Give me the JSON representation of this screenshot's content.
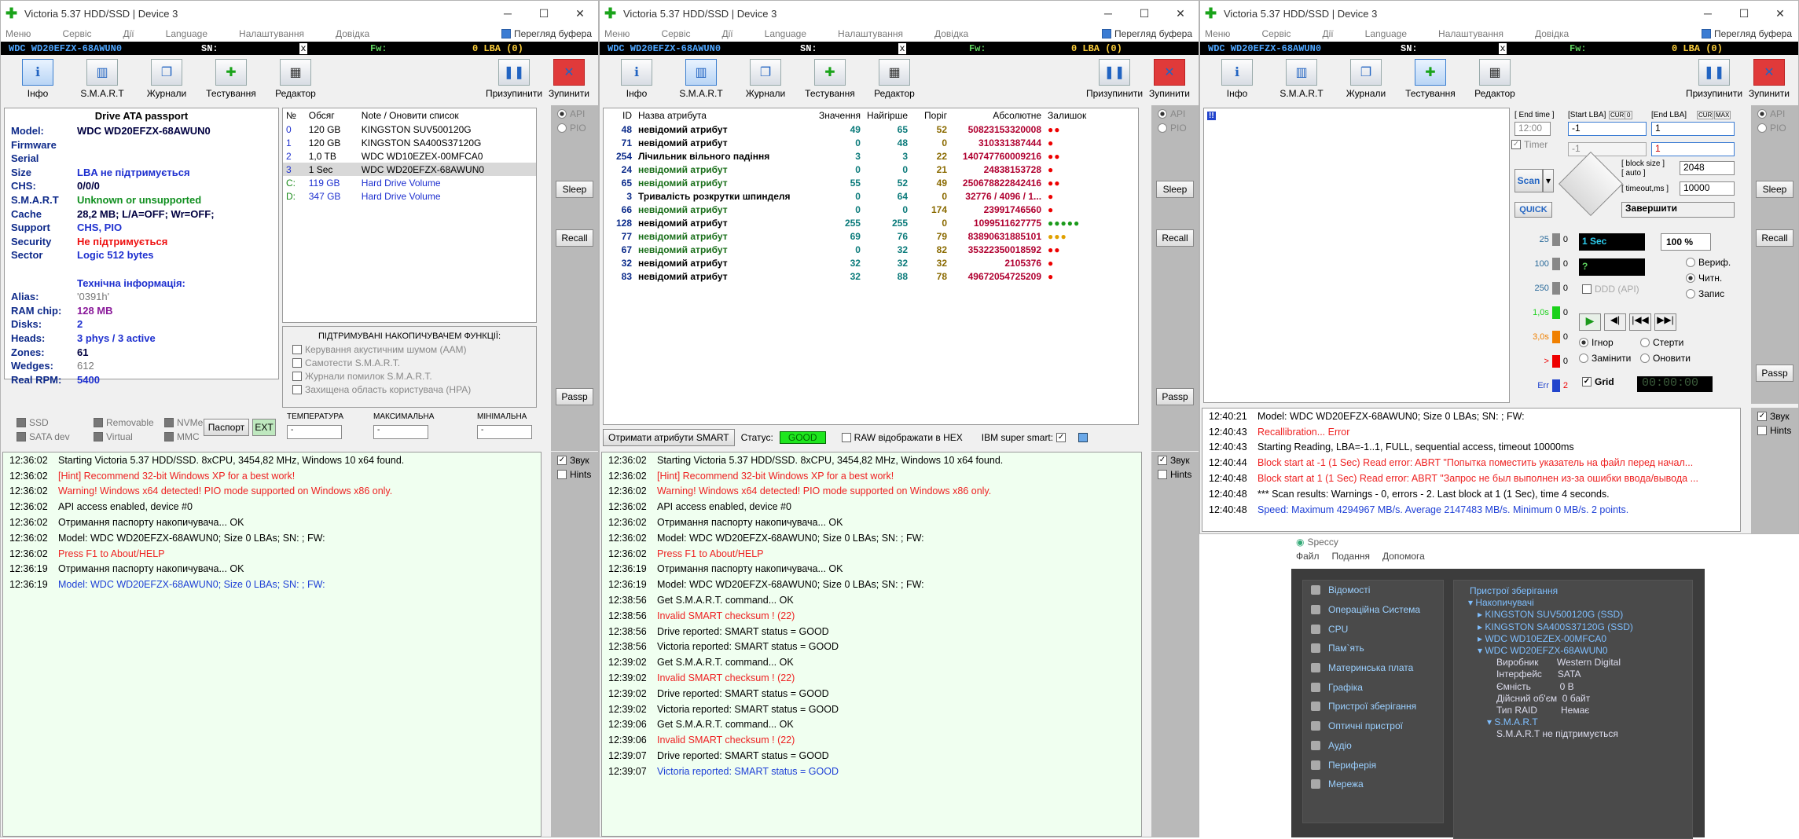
{
  "windows": [
    {
      "title": "Victoria 5.37 HDD/SSD | Device 3"
    },
    {
      "title": "Victoria 5.37 HDD/SSD | Device 3"
    },
    {
      "title": "Victoria 5.37 HDD/SSD | Device 3"
    }
  ],
  "menu": {
    "items": [
      "Меню",
      "Сервіс",
      "Дії",
      "Language",
      "Налаштування",
      "Довідка"
    ],
    "buffer": "Перегляд буфера"
  },
  "devbar": {
    "model": "WDC WD20EFZX-68AWUN0",
    "sn": "SN:",
    "x": "x",
    "fw": "Fw:",
    "lba": "0 LBA (0)"
  },
  "toolbar": {
    "info": "Інфо",
    "smart": "S.M.A.R.T",
    "logs": "Журнали",
    "tests": "Тестування",
    "editor": "Редактор",
    "pause": "Призупинити",
    "stop": "Зупинити"
  },
  "passport": {
    "title": "Drive ATA passport",
    "rows": [
      {
        "k": "Model:",
        "v": "WDC WD20EFZX-68AWUN0",
        "c": ""
      },
      {
        "k": "Firmware",
        "v": "",
        "c": ""
      },
      {
        "k": "Serial",
        "v": "",
        "c": ""
      },
      {
        "k": "Size",
        "v": "LBA не підтримується",
        "c": "blue"
      },
      {
        "k": "CHS:",
        "v": "0/0/0",
        "c": ""
      },
      {
        "k": "S.M.A.R.T",
        "v": "Unknown or unsupported",
        "c": "green"
      },
      {
        "k": "Cache",
        "v": "28,2 MB; L/A=OFF; Wr=OFF;",
        "c": ""
      },
      {
        "k": "Support",
        "v": "CHS, PIO",
        "c": "blue"
      },
      {
        "k": "Security",
        "v": "Не підтримується",
        "c": "red"
      },
      {
        "k": "Sector",
        "v": "Logic 512 bytes",
        "c": "blue"
      },
      {
        "k": "",
        "v": "",
        "c": ""
      },
      {
        "k": "",
        "v": "Технічна інформація:",
        "c": "blue"
      },
      {
        "k": "Alias:",
        "v": "'0391h'",
        "c": "gray"
      },
      {
        "k": "RAM chip:",
        "v": "128 MB",
        "c": "purple"
      },
      {
        "k": "Disks:",
        "v": "2",
        "c": "blue"
      },
      {
        "k": "Heads:",
        "v": "3 phys / 3 active",
        "c": "blue"
      },
      {
        "k": "Zones:",
        "v": "61",
        "c": ""
      },
      {
        "k": "Wedges:",
        "v": "612",
        "c": "gray"
      },
      {
        "k": "Real RPM:",
        "v": "5400",
        "c": "blue"
      }
    ]
  },
  "drives": {
    "headers": [
      "№",
      "Обсяг",
      "Note / Оновити список"
    ],
    "rows": [
      [
        "0",
        "120 GB",
        "KINGSTON SUV500120G"
      ],
      [
        "1",
        "120 GB",
        "KINGSTON SA400S37120G"
      ],
      [
        "2",
        "1,0 TB",
        "WDC WD10EZEX-00MFCA0"
      ],
      [
        "3",
        "1 Sec",
        "WDC WD20EFZX-68AWUN0"
      ],
      [
        "C:",
        "119 GB",
        "Hard Drive Volume"
      ],
      [
        "D:",
        "347 GB",
        "Hard Drive Volume"
      ]
    ]
  },
  "features": {
    "title": "ПІДТРИМУВАНІ НАКОПИЧУВАЧЕМ ФУНКЦІЇ:",
    "items": [
      "Керування акустичним шумом (AAM)",
      "Самотести S.M.A.R.T.",
      "Журнали помилок S.M.A.R.T.",
      "Захищена область користувача (HPA)"
    ]
  },
  "bottom1": {
    "ssd": "SSD",
    "sata": "SATA dev",
    "removable": "Removable",
    "virtual": "Virtual",
    "nvme": "NVMe",
    "mmc": "MMC",
    "passport": "Паспорт",
    "ext": "EXT",
    "temp": "ТЕМПЕРАТУРА",
    "max": "МАКСИМАЛЬНА",
    "min": "МІНІМАЛЬНА",
    "dash": "-"
  },
  "side": {
    "api": "API",
    "pio": "PIO",
    "sleep": "Sleep",
    "recall": "Recall",
    "passp": "Passp",
    "sound": "Звук",
    "hints": "Hints"
  },
  "log1": [
    [
      "12:36:02",
      "Starting Victoria 5.37 HDD/SSD. 8xCPU, 3454,82 MHz, Windows 10 x64 found.",
      ""
    ],
    [
      "12:36:02",
      "[Hint] Recommend 32-bit Windows XP for a best work!",
      "red2"
    ],
    [
      "12:36:02",
      "Warning! Windows x64 detected! PIO mode supported on Windows x86 only.",
      "red2"
    ],
    [
      "12:36:02",
      "API access enabled, device #0",
      ""
    ],
    [
      "12:36:02",
      "Отримання паспорту накопичувача... OK",
      ""
    ],
    [
      "12:36:02",
      "Model: WDC WD20EFZX-68AWUN0; Size 0 LBAs; SN:  ; FW:",
      ""
    ],
    [
      "12:36:02",
      "Press F1 to About/HELP",
      "red2"
    ],
    [
      "12:36:19",
      "Отримання паспорту накопичувача... OK",
      ""
    ],
    [
      "12:36:19",
      "Model: WDC WD20EFZX-68AWUN0; Size 0 LBAs; SN:  ; FW:",
      "blue2"
    ]
  ],
  "smart": {
    "headers": [
      "ID",
      "Назва атрибута",
      "Значення",
      "Найгірше",
      "Поріг",
      "Абсолютне",
      "Залишок"
    ],
    "rows": [
      [
        "48",
        "невідомий атрибут",
        "49",
        "65",
        "52",
        "50823153320008",
        "●●"
      ],
      [
        "71",
        "невідомий атрибут",
        "0",
        "48",
        "0",
        "310331387444",
        "●"
      ],
      [
        "254",
        "Лічильник вільного падіння",
        "3",
        "3",
        "22",
        "140747760009216",
        "●●"
      ],
      [
        "24",
        "невідомий атрибут",
        "0",
        "0",
        "21",
        "24838153728",
        "●"
      ],
      [
        "65",
        "невідомий атрибут",
        "55",
        "52",
        "49",
        "250678822842416",
        "●●"
      ],
      [
        "3",
        "Тривалість розкрутки шпинделя",
        "0",
        "64",
        "0",
        "32776 / 4096 / 1...",
        "●"
      ],
      [
        "66",
        "невідомий атрибут",
        "0",
        "0",
        "174",
        "23991746560",
        "●"
      ],
      [
        "128",
        "невідомий атрибут",
        "255",
        "255",
        "0",
        "1099511627775",
        "●●●●●"
      ],
      [
        "77",
        "невідомий атрибут",
        "69",
        "76",
        "79",
        "83890631885101",
        "●●●"
      ],
      [
        "67",
        "невідомий атрибут",
        "0",
        "32",
        "82",
        "35322350018592",
        "●●"
      ],
      [
        "32",
        "невідомий атрибут",
        "32",
        "32",
        "32",
        "2105376",
        "●"
      ],
      [
        "83",
        "невідомий атрибут",
        "32",
        "88",
        "78",
        "49672054725209",
        "●"
      ]
    ]
  },
  "smartbar": {
    "get": "Отримати атрибути SMART",
    "status_label": "Статус:",
    "status": "GOOD",
    "raw": "RAW відображати в HEX",
    "ibm": "IBM super smart:"
  },
  "log2": [
    [
      "12:36:02",
      "Starting Victoria 5.37 HDD/SSD. 8xCPU, 3454,82 MHz, Windows 10 x64 found.",
      ""
    ],
    [
      "12:36:02",
      "[Hint] Recommend 32-bit Windows XP for a best work!",
      "red2"
    ],
    [
      "12:36:02",
      "Warning! Windows x64 detected! PIO mode supported on Windows x86 only.",
      "red2"
    ],
    [
      "12:36:02",
      "API access enabled, device #0",
      ""
    ],
    [
      "12:36:02",
      "Отримання паспорту накопичувача... OK",
      ""
    ],
    [
      "12:36:02",
      "Model: WDC WD20EFZX-68AWUN0; Size 0 LBAs; SN:  ; FW:",
      ""
    ],
    [
      "12:36:02",
      "Press F1 to About/HELP",
      "red2"
    ],
    [
      "12:36:19",
      "Отримання паспорту накопичувача... OK",
      ""
    ],
    [
      "12:36:19",
      "Model: WDC WD20EFZX-68AWUN0; Size 0 LBAs; SN:  ; FW:",
      ""
    ],
    [
      "12:38:56",
      "Get S.M.A.R.T. command... OK",
      ""
    ],
    [
      "12:38:56",
      "Invalid SMART checksum ! (22)",
      "red2"
    ],
    [
      "12:38:56",
      "Drive reported: SMART status = GOOD",
      ""
    ],
    [
      "12:38:56",
      "Victoria reported: SMART status = GOOD",
      ""
    ],
    [
      "12:39:02",
      "Get S.M.A.R.T. command... OK",
      ""
    ],
    [
      "12:39:02",
      "Invalid SMART checksum ! (22)",
      "red2"
    ],
    [
      "12:39:02",
      "Drive reported: SMART status = GOOD",
      ""
    ],
    [
      "12:39:02",
      "Victoria reported: SMART status = GOOD",
      ""
    ],
    [
      "12:39:06",
      "Get S.M.A.R.T. command... OK",
      ""
    ],
    [
      "12:39:06",
      "Invalid SMART checksum ! (22)",
      "red2"
    ],
    [
      "12:39:07",
      "Drive reported: SMART status = GOOD",
      ""
    ],
    [
      "12:39:07",
      "Victoria reported: SMART status = GOOD",
      "blue2"
    ]
  ],
  "test": {
    "end_time": "[ End time ]",
    "start_lba": "[Start LBA]",
    "cur": "CUR",
    "zero": "0",
    "end_lba": "[End LBA]",
    "max": "MAX",
    "time": "12:00",
    "start_val": "-1",
    "end_val": "1",
    "timer": "Timer",
    "timer_val": "-1",
    "end_val2": "1",
    "scan": "Scan",
    "quick": "QUICK",
    "block_size": "[ block size ]",
    "auto": "[ auto ]",
    "bs_val": "2048",
    "timeout": "[ timeout,ms ]",
    "to_val": "10000",
    "finish": "Завершити",
    "one_sec": "1 Sec",
    "pct": "100 %",
    "q": "?",
    "ddd": "DDD (API)",
    "verify": "Вериф.",
    "read": "Читн.",
    "write": "Запис",
    "ignore": "Ігнор",
    "erase": "Стерти",
    "replace": "Замінити",
    "update": "Оновити",
    "grid": "Grid",
    "timer_disp": "00:00:00",
    "mark": "!!",
    "hist": [
      [
        "25",
        "0"
      ],
      [
        "100",
        "0"
      ],
      [
        "250",
        "0"
      ],
      [
        "1,0s",
        "0"
      ],
      [
        "3,0s",
        "0"
      ],
      [
        ">",
        "0"
      ],
      [
        "Err",
        "2"
      ]
    ]
  },
  "log3": [
    [
      "12:40:21",
      "Model: WDC WD20EFZX-68AWUN0; Size 0 LBAs; SN:  ; FW:",
      ""
    ],
    [
      "12:40:43",
      "Recallibration... Error",
      "red2"
    ],
    [
      "12:40:43",
      "Starting Reading, LBA=-1..1, FULL, sequential access, timeout 10000ms",
      ""
    ],
    [
      "12:40:44",
      "Block start at -1 (1 Sec) Read error: ABRT \"Попытка поместить указатель на файл перед начал...",
      "red2"
    ],
    [
      "12:40:48",
      "Block start at 1 (1 Sec) Read error: ABRT \"Запрос не был выполнен из-за ошибки ввода/вывода ...",
      "red2"
    ],
    [
      "12:40:48",
      "*** Scan results: Warnings - 0, errors - 2. Last block at 1 (1 Sec), time 4 seconds.",
      ""
    ],
    [
      "12:40:48",
      "Speed: Maximum 4294967 MB/s. Average 2147483 MB/s. Minimum 0 MB/s. 2 points.",
      "blue2"
    ]
  ],
  "speccy": {
    "title": "Speccy",
    "menu": [
      "Файл",
      "Подання",
      "Допомога"
    ],
    "left": [
      "Відомості",
      "Операційна Система",
      "CPU",
      "Пам`ять",
      "Материнська плата",
      "Графіка",
      "Пристрої зберігання",
      "Оптичні пристрої",
      "Аудіо",
      "Периферія",
      "Мережа"
    ],
    "right": [
      {
        "t": "Пристрої зберігання",
        "c": "lt",
        "i": 0
      },
      {
        "t": "▾ Накопичувачі",
        "c": "lt",
        "i": 1
      },
      {
        "t": "▸ KINGSTON SUV500120G (SSD)",
        "c": "lt",
        "i": 2
      },
      {
        "t": "▸ KINGSTON SA400S37120G (SSD)",
        "c": "lt",
        "i": 2
      },
      {
        "t": "▸ WDC WD10EZEX-00MFCA0",
        "c": "lt",
        "i": 2
      },
      {
        "t": "▾ WDC WD20EFZX-68AWUN0",
        "c": "lt",
        "i": 2
      },
      {
        "t": "Виробник       Western Digital",
        "c": "",
        "i": 4
      },
      {
        "t": "Інтерфейс      SATA",
        "c": "",
        "i": 4
      },
      {
        "t": "Ємність           0 B",
        "c": "",
        "i": 4
      },
      {
        "t": "Дійсний об'єм  0 байт",
        "c": "",
        "i": 4
      },
      {
        "t": "Тип RAID         Немає",
        "c": "",
        "i": 4
      },
      {
        "t": "▾ S.M.A.R.T",
        "c": "lt",
        "i": 3
      },
      {
        "t": "S.M.A.R.T не підтримується",
        "c": "",
        "i": 4
      }
    ]
  }
}
